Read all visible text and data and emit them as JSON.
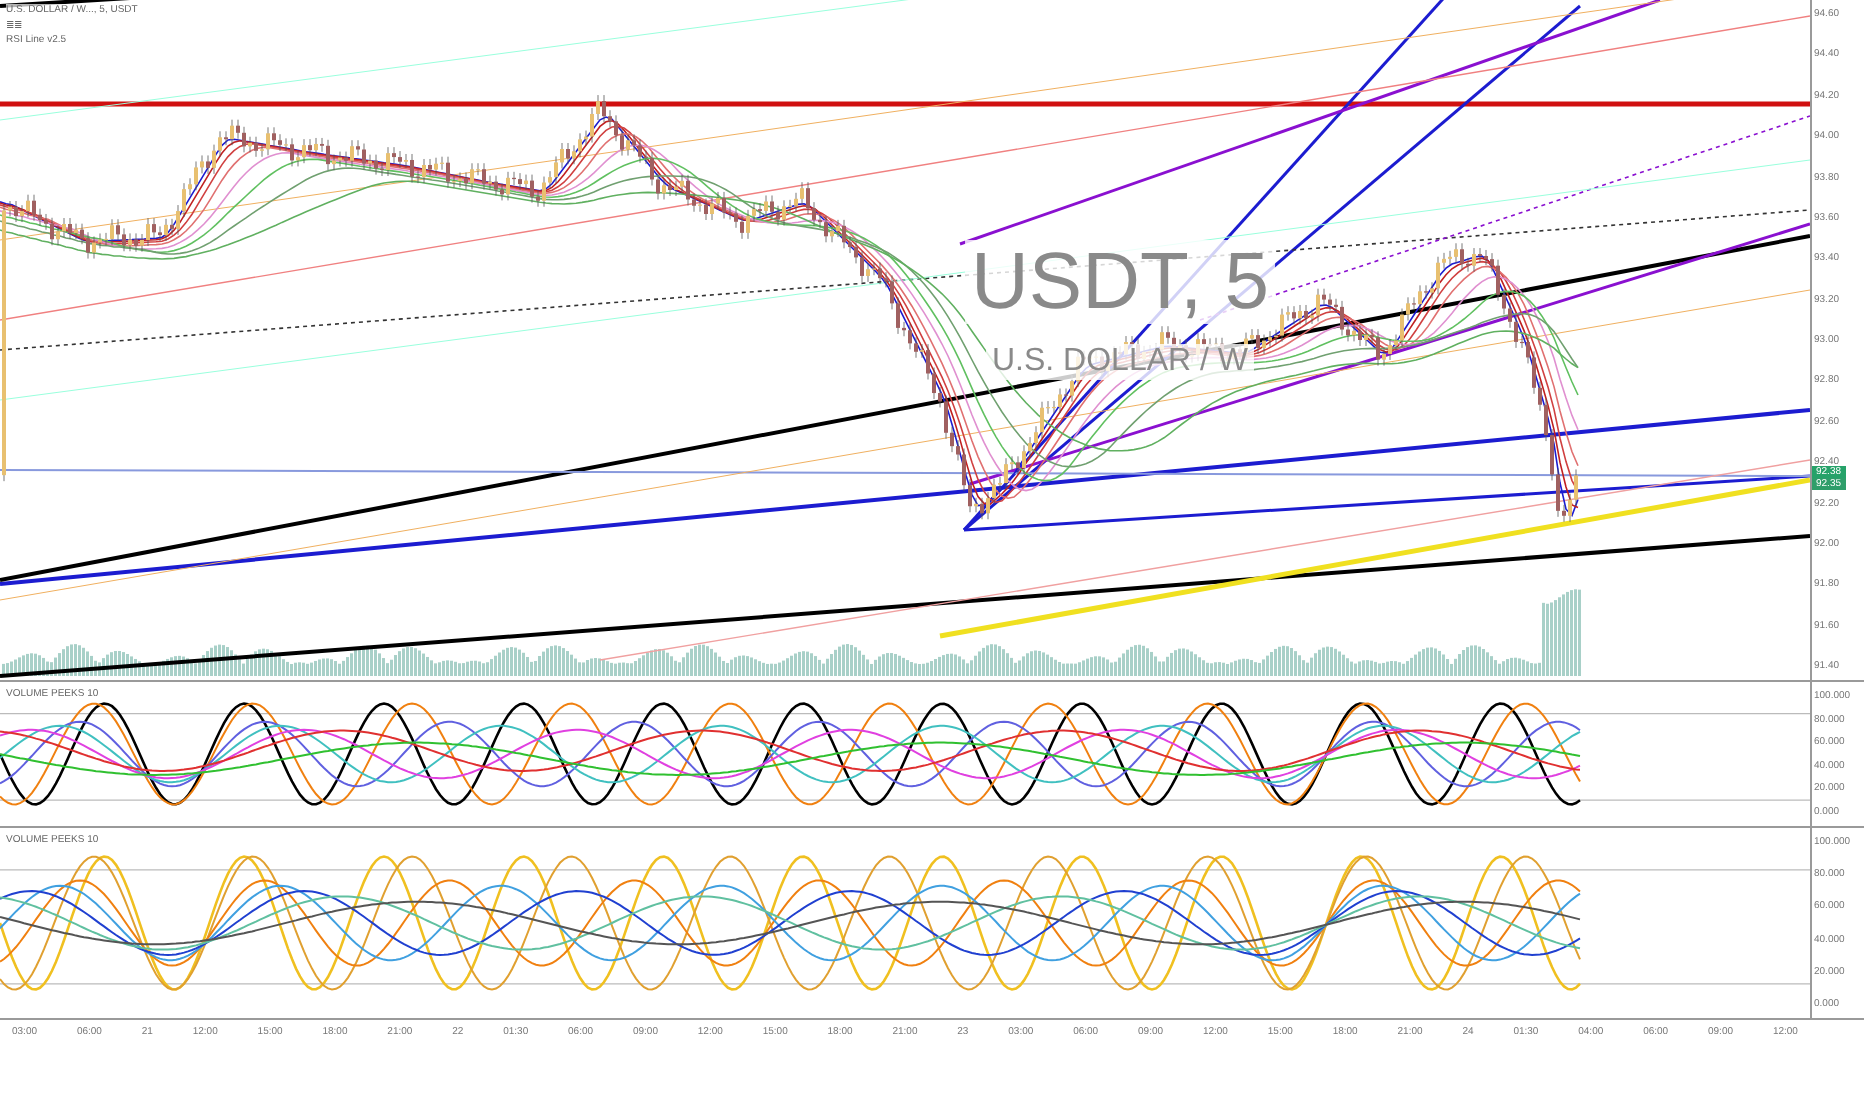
{
  "legend": {
    "title": "U.S. DOLLAR / W..., 5, USDT",
    "flags": "≣≣",
    "indicator": "RSI Line v2.5"
  },
  "watermark": {
    "symbol": "USDT, 5",
    "name": "U.S. DOLLAR / W"
  },
  "price_axis": {
    "ticks": [
      "94.60",
      "94.40",
      "94.20",
      "94.00",
      "93.80",
      "93.60",
      "93.40",
      "93.20",
      "93.00",
      "92.80",
      "92.60",
      "92.40",
      "92.20",
      "92.00",
      "91.80",
      "91.60",
      "91.40"
    ],
    "tags": [
      {
        "text": "92.38",
        "color": "#26a269"
      },
      {
        "text": "92.35",
        "color": "#2e9e6a"
      }
    ]
  },
  "oscillators": [
    {
      "title": "VOLUME PEEKS 10",
      "ticks": [
        "100.000",
        "80.000",
        "60.000",
        "40.000",
        "20.000",
        "0.000"
      ]
    },
    {
      "title": "VOLUME PEEKS 10",
      "ticks": [
        "100.000",
        "80.000",
        "60.000",
        "40.000",
        "20.000",
        "0.000"
      ]
    }
  ],
  "time_axis": [
    "03:00",
    "06:00",
    "21",
    "12:00",
    "15:00",
    "18:00",
    "21:00",
    "22",
    "01:30",
    "06:00",
    "09:00",
    "12:00",
    "15:00",
    "18:00",
    "21:00",
    "23",
    "03:00",
    "06:00",
    "09:00",
    "12:00",
    "15:00",
    "18:00",
    "21:00",
    "24",
    "01:30",
    "04:00",
    "06:00",
    "09:00",
    "12:00"
  ]
}
